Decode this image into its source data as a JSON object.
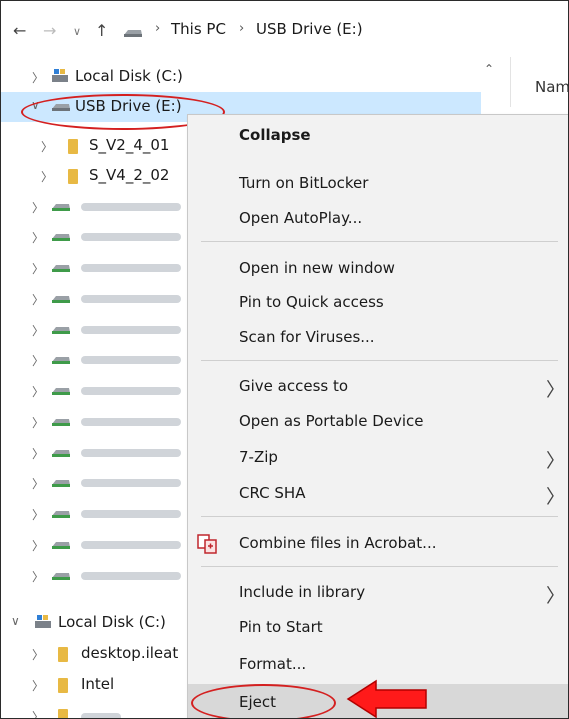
{
  "address_bar": {
    "back_icon": "arrow-left-icon",
    "forward_icon": "arrow-right-icon",
    "recent_icon": "chevron-down-icon",
    "up_icon": "arrow-up-icon",
    "crumbs": [
      "This PC",
      "USB Drive (E:)"
    ]
  },
  "tree": {
    "local_disk_top": "Local Disk (C:)",
    "usb_drive": "USB Drive (E:)",
    "folder_1": "S_V2_4_01",
    "folder_2": "S_V4_2_02",
    "local_disk_bottom": "Local Disk (C:)",
    "desktop": "desktop.ileat",
    "intel": "Intel"
  },
  "content": {
    "name_column": "Nam"
  },
  "context_menu": {
    "items": [
      {
        "label": "Collapse"
      },
      {
        "label": "Turn on BitLocker"
      },
      {
        "label": "Open AutoPlay..."
      },
      {
        "label": "Open in new window"
      },
      {
        "label": "Pin to Quick access"
      },
      {
        "label": "Scan for Viruses..."
      },
      {
        "label": "Give access to"
      },
      {
        "label": "Open as Portable Device"
      },
      {
        "label": "7-Zip"
      },
      {
        "label": "CRC SHA"
      },
      {
        "label": "Combine files in Acrobat..."
      },
      {
        "label": "Include in library"
      },
      {
        "label": "Pin to Start"
      },
      {
        "label": "Format..."
      },
      {
        "label": "Eject"
      }
    ]
  },
  "colors": {
    "selection": "#cce8ff",
    "annotation_red": "#d42020",
    "menu_background": "#f2f2f2"
  }
}
